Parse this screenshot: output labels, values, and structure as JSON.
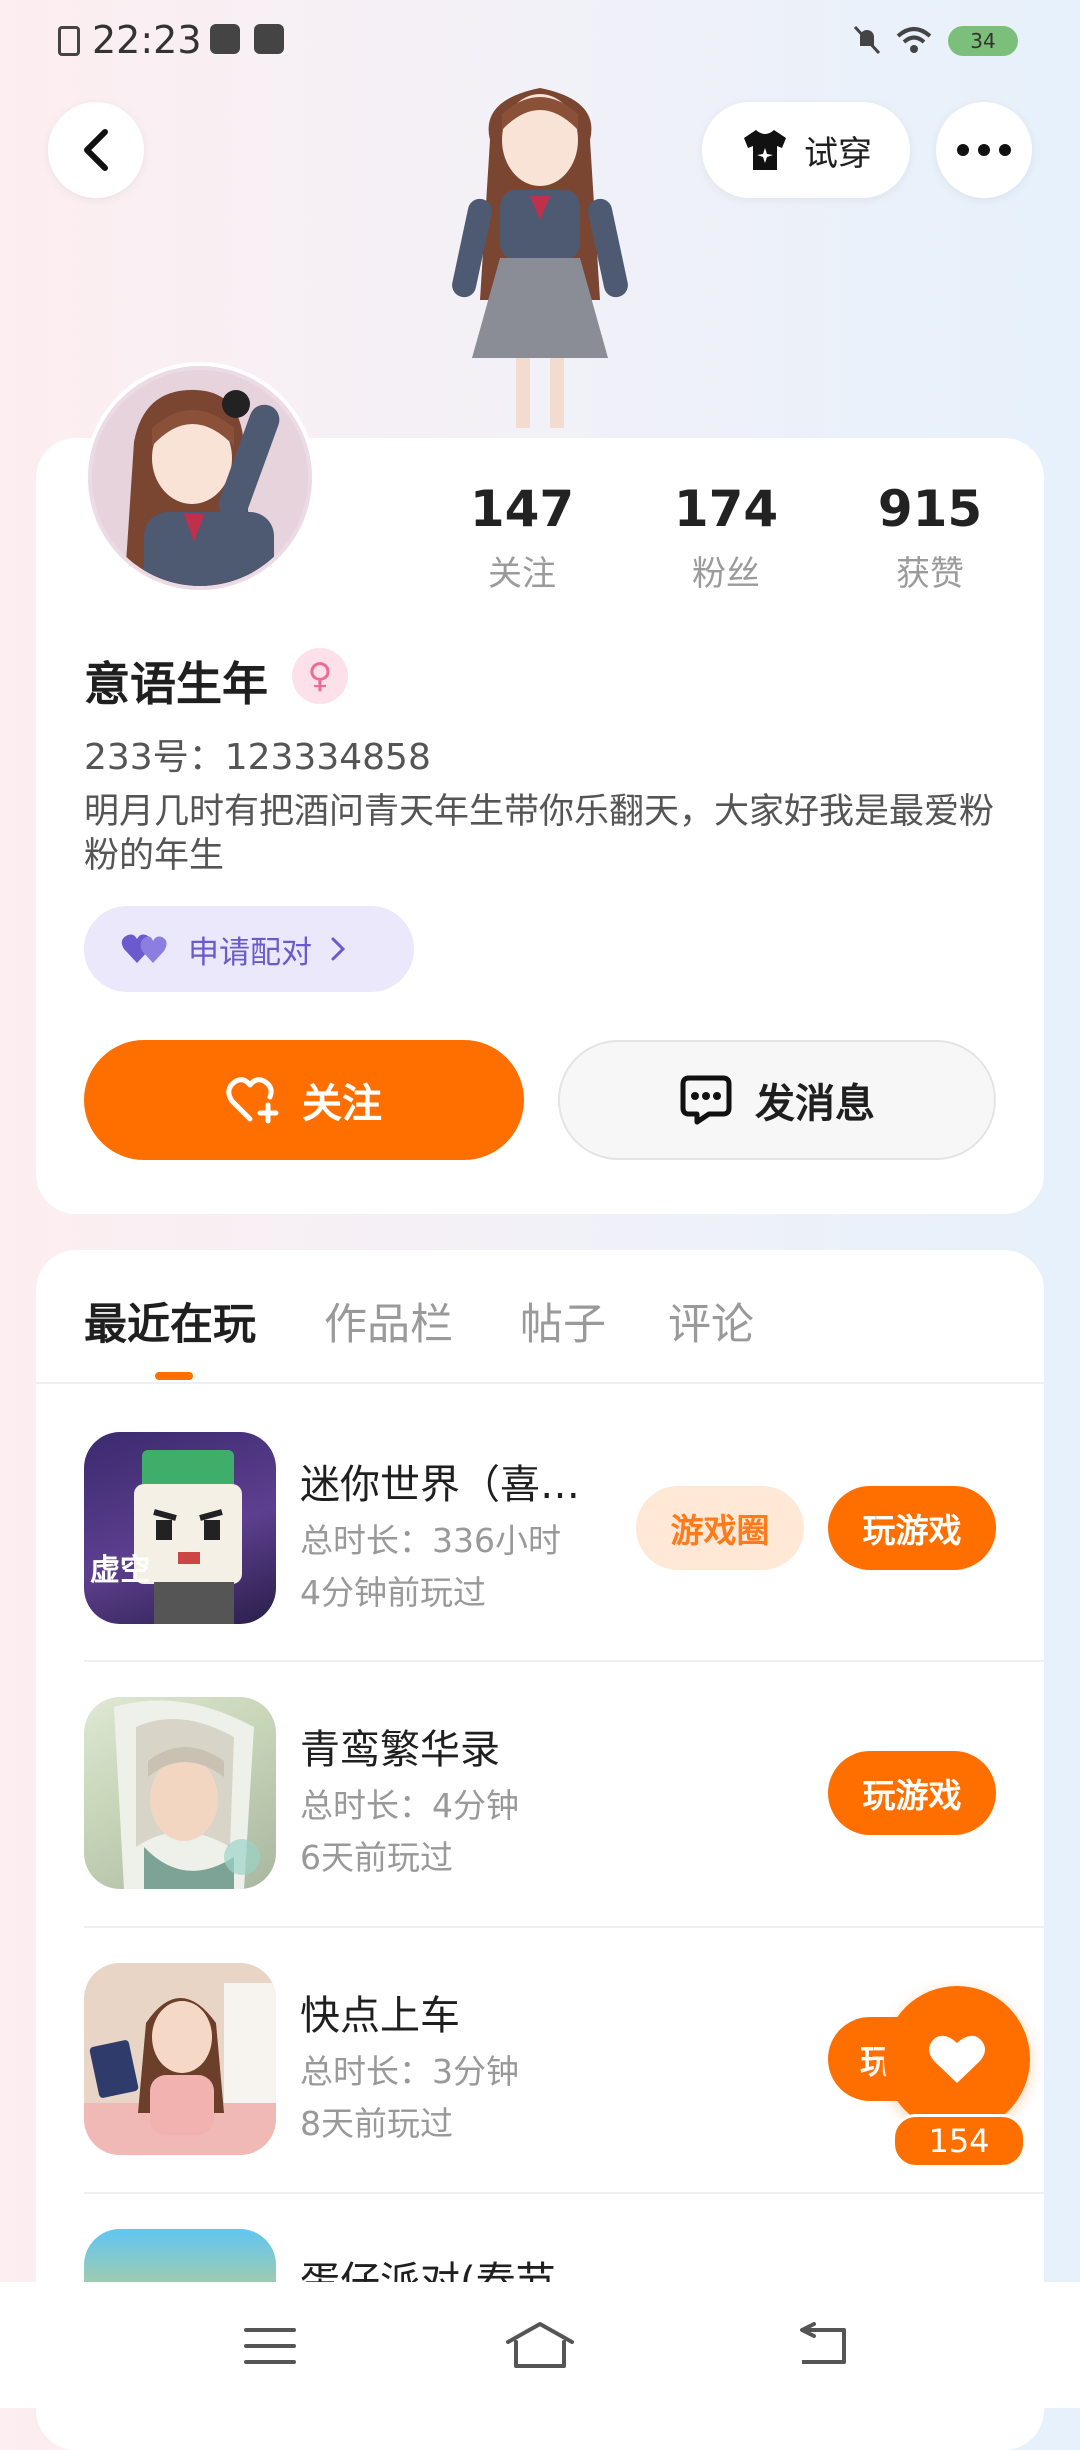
{
  "status": {
    "time": "22:23",
    "battery": "34"
  },
  "header": {
    "try_on_label": "试穿"
  },
  "profile": {
    "stats": [
      {
        "value": "147",
        "label": "关注"
      },
      {
        "value": "174",
        "label": "粉丝"
      },
      {
        "value": "915",
        "label": "获赞"
      }
    ],
    "name": "意语生年",
    "gender_symbol": "♀",
    "uid": "233号：123334858",
    "bio": "明月几时有把酒问青天年生带你乐翻天，大家好我是最爱粉粉的年生",
    "pair_label": "申请配对",
    "follow_label": "关注",
    "message_label": "发消息"
  },
  "tabs": [
    {
      "label": "最近在玩",
      "active": true
    },
    {
      "label": "作品栏",
      "active": false
    },
    {
      "label": "帖子",
      "active": false
    },
    {
      "label": "评论",
      "active": false
    }
  ],
  "games": [
    {
      "title": "迷你世界（喜…",
      "duration": "总时长：336小时",
      "last_played": "4分钟前玩过",
      "circle_label": "游戏圈",
      "play_label": "玩游戏",
      "icon_text": "虚空"
    },
    {
      "title": "青鸾繁华录",
      "duration": "总时长：4分钟",
      "last_played": "6天前玩过",
      "play_label": "玩游戏"
    },
    {
      "title": "快点上车",
      "duration": "总时长：3分钟",
      "last_played": "8天前玩过",
      "play_label": "玩"
    },
    {
      "title": "蛋仔派对(春节…"
    }
  ],
  "like": {
    "count": "154"
  },
  "colors": {
    "accent": "#ff6f00",
    "pair_bg": "#ebe8fb",
    "pair_text": "#6a5acd"
  }
}
